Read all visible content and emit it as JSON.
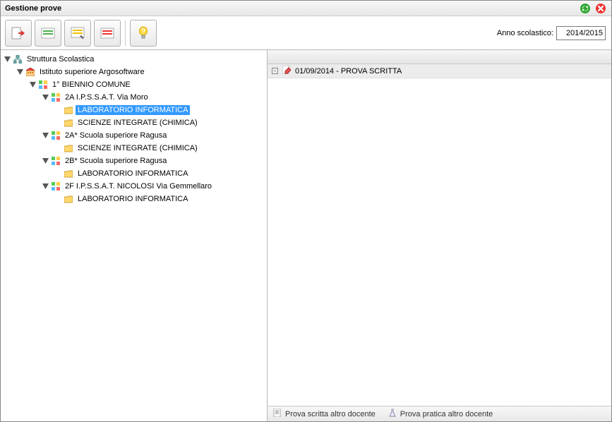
{
  "window": {
    "title": "Gestione prove"
  },
  "toolbar": {
    "year_label": "Anno scolastico:",
    "year_value": "2014/2015"
  },
  "tree": {
    "root": {
      "label": "Struttura Scolastica",
      "children": [
        {
          "label": "Istituto superiore Argosoftware",
          "children": [
            {
              "label": "1° BIENNIO COMUNE",
              "children": [
                {
                  "label": "2A I.P.S.S.A.T. Via Moro",
                  "children": [
                    {
                      "label": "LABORATORIO INFORMATICA",
                      "selected": true
                    },
                    {
                      "label": "SCIENZE INTEGRATE (CHIMICA)"
                    }
                  ]
                },
                {
                  "label": "2A* Scuola superiore Ragusa",
                  "children": [
                    {
                      "label": "SCIENZE INTEGRATE (CHIMICA)"
                    }
                  ]
                },
                {
                  "label": "2B* Scuola superiore Ragusa",
                  "children": [
                    {
                      "label": "LABORATORIO INFORMATICA"
                    }
                  ]
                },
                {
                  "label": "2F I.P.S.S.A.T. NICOLOSI Via Gemmellaro",
                  "children": [
                    {
                      "label": "LABORATORIO INFORMATICA"
                    }
                  ]
                }
              ]
            }
          ]
        }
      ]
    }
  },
  "list": {
    "items": [
      {
        "exp": "-",
        "label": "01/09/2014 - PROVA SCRITTA"
      }
    ]
  },
  "footer": {
    "legend1": "Prova scritta altro docente",
    "legend2": "Prova pratica altro docente"
  }
}
